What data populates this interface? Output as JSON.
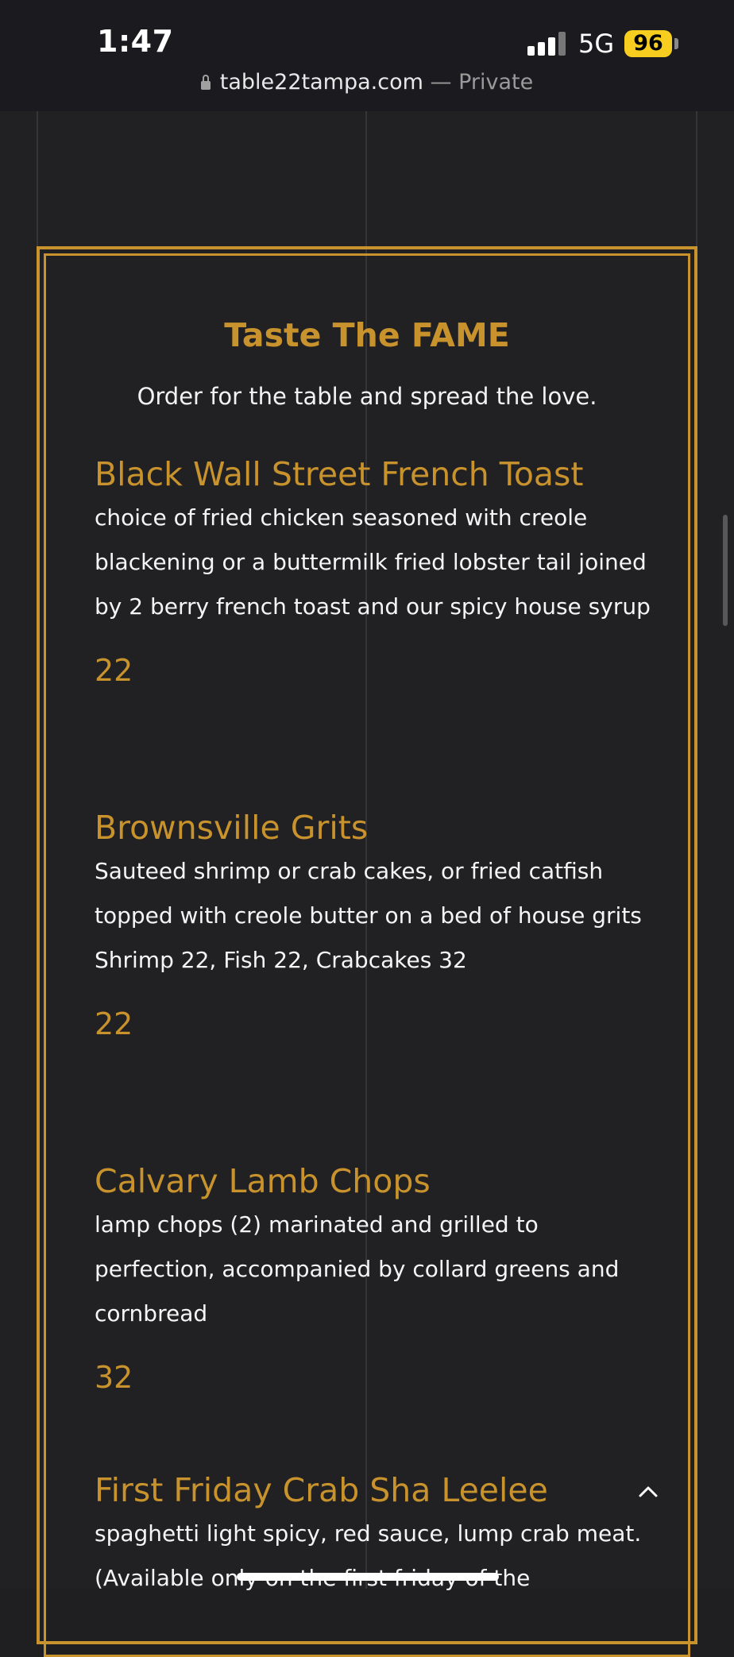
{
  "status_bar": {
    "time": "1:47",
    "network": "5G",
    "battery": "96",
    "battery_color": "#f7cd1f"
  },
  "browser": {
    "url": "table22tampa.com",
    "privacy": "— Private"
  },
  "theme": {
    "accent": "#c8922c",
    "background": "#212124"
  },
  "menu": {
    "title": "Taste The FAME",
    "subtitle": "Order for the table and spread the love.",
    "items": [
      {
        "name": "Black Wall Street French Toast",
        "description": "choice of fried chicken seasoned with creole blackening or a buttermilk fried lobster tail joined by 2 berry french toast and our spicy house syrup",
        "extra": "",
        "price": "22"
      },
      {
        "name": "Brownsville Grits",
        "description": "Sauteed shrimp or crab cakes, or fried catfish topped with creole butter on a bed of house grits",
        "extra": "Shrimp 22, Fish 22, Crabcakes 32",
        "price": "22"
      },
      {
        "name": "Calvary Lamb Chops",
        "description": "lamp chops (2) marinated and grilled to perfection, accompanied by collard greens and cornbread",
        "extra": "",
        "price": "32"
      },
      {
        "name": "First Friday Crab Sha Leelee",
        "description": "spaghetti light spicy, red sauce, lump crab meat. (Available only on the first friday of the",
        "extra": "",
        "price": ""
      }
    ]
  },
  "icons": {
    "scroll_top": "chevron-up-icon",
    "lock": "lock-icon"
  }
}
